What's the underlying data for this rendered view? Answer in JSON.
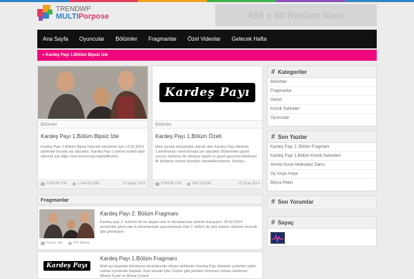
{
  "colors": {
    "accent_pink": "#ee0a7c",
    "nav_bg": "#111111",
    "logo_blue": "#2f84c6",
    "logo_pink": "#d93a69"
  },
  "topbar_colors": [
    "#2f84c6",
    "#e23b5e",
    "#f0a21b",
    "#3fb04a",
    "#8a4fb7",
    "#2f84c6"
  ],
  "logo": {
    "line1": "TRENDWP",
    "line2a": "MULTI",
    "line2b": "Porpose"
  },
  "ad": {
    "text": "468 x 60 Reklam Alanı"
  },
  "nav": [
    "Ana Sayfa",
    "Oyuncular",
    "Bölümler",
    "Fragmanlar",
    "Özel Videolar",
    "Gelecek Hafta"
  ],
  "breadcrumb": "« Kardeş Payı 1.Bölüm Bipsiz İzle",
  "posts": [
    {
      "category": "Bölümler",
      "title": "Kardeş Payı 1.Bölüm Bipsiz İzle",
      "excerpt": "Kardeş Payı 1.Bölüm Bipsiz İzlemek isteyenler için 14.02.2014 tarihinde burada yer alacaktır. Kardeş Payı 1.bölüm özetini bipli izlemek için diğer özet konumuza bakabilirsiniz.",
      "comments": "YORUM YOK",
      "views": "1.444 İZLEME",
      "date": "13 Şubat 2014"
    },
    {
      "category": "Bölümler",
      "title": "Kardeş Payı 1.Bölüm Özeti",
      "excerpt": "Mart ayında ekranlarda olacak olan Kardeş Payı dizisinin 1.bölümünün özeti burada yer alacaktır. Birbirinden güzel oyuncu kadrosu ile oldukça neşeli ve güzel geçmesi beklenen ilk bölümün özetini buradan izleyebileceksiniz. Kardeş...",
      "comments": "YORUM YOK",
      "views": "884 İZLEME",
      "date": "12 Ocak 2014"
    }
  ],
  "fragmanlar": {
    "title": "Fragmanlar",
    "items": [
      {
        "title": "Kardeş Payı 2. Bölüm Fragmanı",
        "excerpt": "Kardeş payı 2. bölümü ile bu akşam star tv ekranlarında sizlerle buluşuyor. 28.02.2014 perşembe günü star tv ekranlarında yayınlanacak olan 2. bölüm ile yine izleme rekorları kıracak gibi görünüyor.",
        "comments": "Yorum Yok",
        "views": "470 İzleme"
      },
      {
        "title": "Kardeş Payı 1.Bölüm Fragmanı",
        "excerpt": "Mart ayı başında televizyon ekranlarında olması beklenen Kardeş Payı dizisinin çekimleri yakın zaman içerisinde başladı. Kısa sürede İşler Güçler gibi yeniden fenomen olması beklenen Ahmet Kural ve Murat Cemcir"
      }
    ]
  },
  "logo_art_text": "Kardeş Payı",
  "sidebar": {
    "kategoriler": {
      "title": "Kategoriler",
      "items": [
        "Bölümler",
        "Fragmanlar",
        "Genel",
        "Komik Sahneler",
        "Oyuncular"
      ]
    },
    "son_yazilar": {
      "title": "Son Yazılar",
      "items": [
        "Kardeş Payı 2. Bölüm Fragmanı",
        "Kardeş Payı 1.Bölüm Komik Sahneleri",
        "Ahmet Kural Helikopter Dansı",
        "Oy Asiye Asiye",
        "Büşra Pekin"
      ]
    },
    "son_yorumlar": {
      "title": "Son Yorumlar"
    },
    "sayac": {
      "title": "Sayaç"
    }
  }
}
